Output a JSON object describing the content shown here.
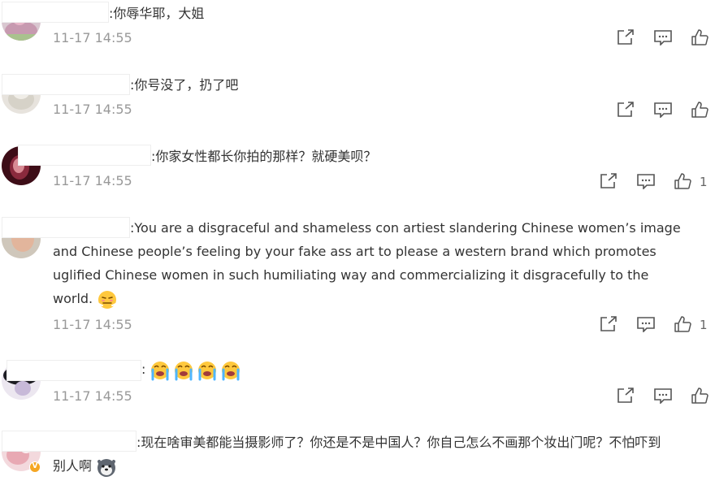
{
  "comments": [
    {
      "text": "你辱华耶，大姐",
      "timestamp": "11-17 14:55",
      "likes": ""
    },
    {
      "text": "你号没了，扔了吧",
      "timestamp": "11-17 14:55",
      "likes": ""
    },
    {
      "text": "你家女性都长你拍的那样？就硬美呗？",
      "timestamp": "11-17 14:55",
      "likes": "1"
    },
    {
      "text_line1": "You are a disgraceful and shameless con artiest slandering Chinese women’s image",
      "text_line2": "and Chinese people’s feeling by your fake ass art to please a western brand which promotes",
      "text_line3": "uglified Chinese women in such humiliating way and commercializing it disgracefully to the",
      "text_line4": "world.",
      "emoji": "angry-huff-emoji",
      "timestamp": "11-17 14:55",
      "likes": "1"
    },
    {
      "text": "",
      "emoji": "crying-emoji",
      "emoji_count": 4,
      "timestamp": "11-17 14:55",
      "likes": ""
    },
    {
      "text_line1": "现在啥审美都能当摄影师了？你还是不是中国人？你自己怎么不画那个妆出门呢？不怕吓到",
      "text_line2": "别人啊",
      "emoji": "husky-dog-emoji",
      "avatar_badge": "verified-badge",
      "avatar_badge_text": "V"
    }
  ],
  "separator": ":",
  "icons": {
    "share": "share-icon",
    "comment": "comment-icon",
    "like": "thumbs-up-icon"
  },
  "colors": {
    "text": "#333333",
    "timestamp": "#999999",
    "icon": "#555555",
    "badge": "#f5a623"
  }
}
